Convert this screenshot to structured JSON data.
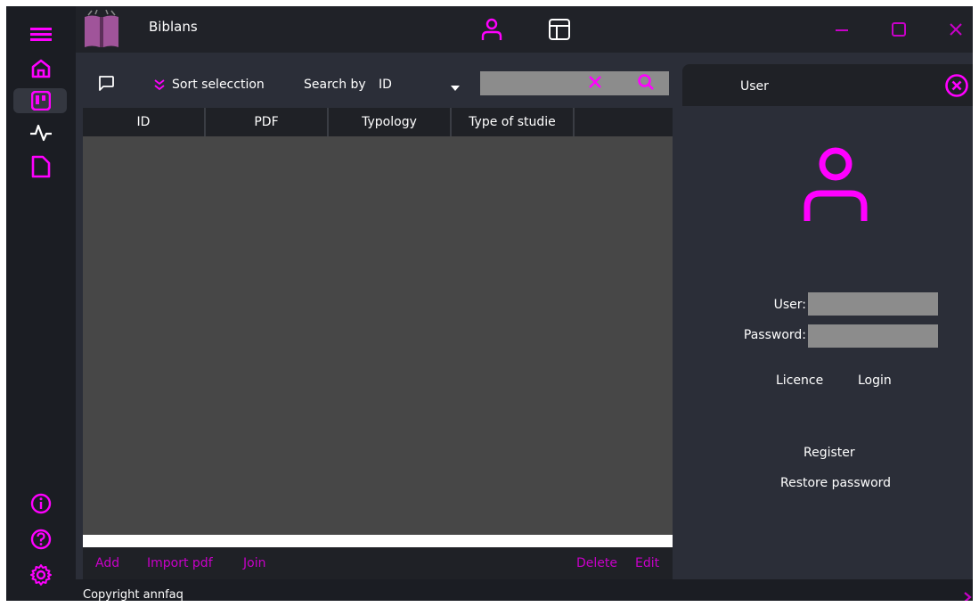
{
  "app": {
    "title": "Biblans"
  },
  "toolbar": {
    "sort_label": "Sort selecction",
    "search_by_label": "Search by",
    "search_by_value": "ID",
    "search_value": ""
  },
  "table": {
    "columns": [
      "ID",
      "PDF",
      "Typology",
      "Type of studie"
    ],
    "rows": []
  },
  "actions": {
    "add": "Add",
    "import_pdf": "Import pdf",
    "join": "Join",
    "delete": "Delete",
    "edit": "Edit"
  },
  "status": {
    "copyright": "Copyright annfaq"
  },
  "user_panel": {
    "title": "User",
    "user_label": "User:",
    "password_label": "Password:",
    "user_value": "",
    "password_value": "",
    "licence": "Licence",
    "login": "Login",
    "register": "Register",
    "restore_password": "Restore password"
  },
  "colors": {
    "accent": "#c800c8",
    "accent_bright": "#ff00ff",
    "background": "#2b2e38",
    "sidebar": "#1b1d23",
    "table_bg": "#474747"
  },
  "icons": {
    "left_bar": [
      "menu-icon",
      "home-icon",
      "board-icon",
      "activity-icon",
      "file-icon",
      "info-icon",
      "help-icon",
      "settings-icon"
    ],
    "titlebar": [
      "user-icon",
      "layout-icon"
    ]
  }
}
